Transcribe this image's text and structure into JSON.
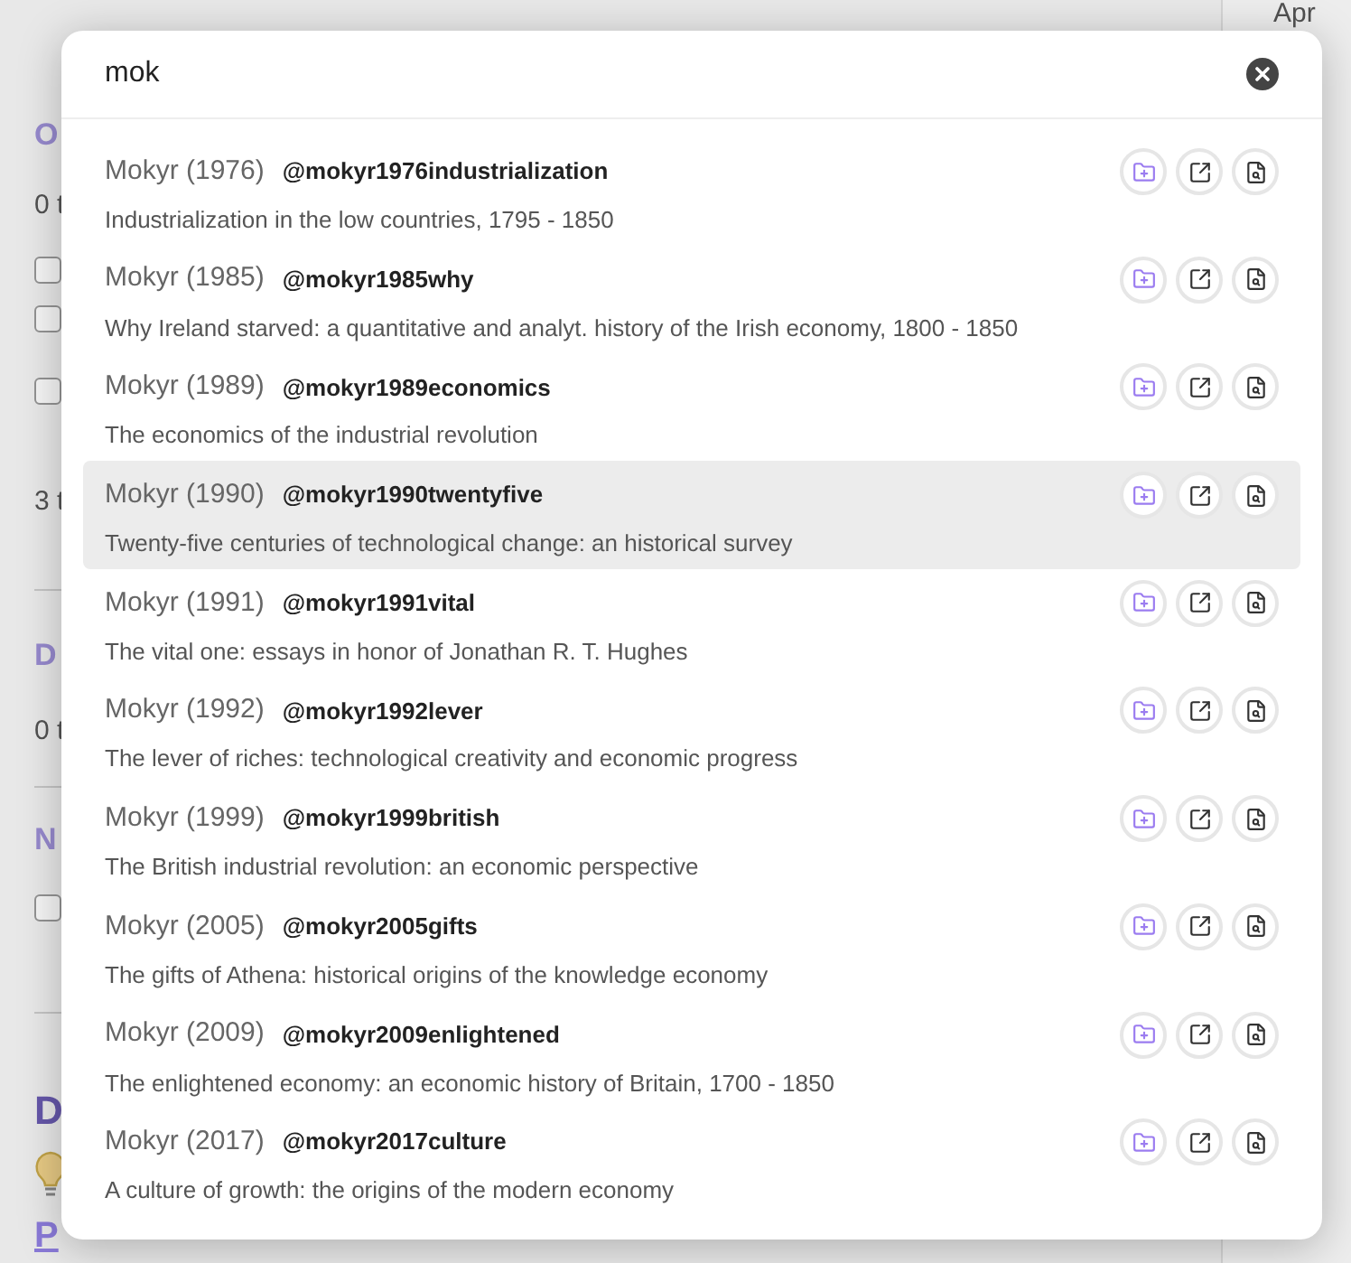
{
  "background": {
    "left_fragments": [
      {
        "kind": "heading",
        "text": "O"
      },
      {
        "kind": "text",
        "text": "0 t"
      },
      {
        "kind": "checkbox",
        "checked": false
      },
      {
        "kind": "checkbox",
        "checked": false
      },
      {
        "kind": "checkbox",
        "checked": false
      },
      {
        "kind": "text",
        "text": "3 t"
      },
      {
        "kind": "divider"
      },
      {
        "kind": "heading",
        "text": "D"
      },
      {
        "kind": "text",
        "text": "0 t"
      },
      {
        "kind": "divider"
      },
      {
        "kind": "heading",
        "text": "N"
      },
      {
        "kind": "checkbox",
        "checked": false
      },
      {
        "kind": "divider"
      },
      {
        "kind": "title",
        "text": "D"
      },
      {
        "kind": "bulb"
      },
      {
        "kind": "link",
        "text": "P"
      }
    ],
    "right_heading": "Apr"
  },
  "search": {
    "value": "mok"
  },
  "results": [
    {
      "author": "Mokyr (1976)",
      "key": "@mokyr1976industrialization",
      "title": "Industrialization in the low countries, 1795 - 1850",
      "selected": false
    },
    {
      "author": "Mokyr (1985)",
      "key": "@mokyr1985why",
      "title": "Why Ireland starved: a quantitative and analyt. history of the Irish economy, 1800 - 1850",
      "selected": false
    },
    {
      "author": "Mokyr (1989)",
      "key": "@mokyr1989economics",
      "title": "The economics of the industrial revolution",
      "selected": false
    },
    {
      "author": "Mokyr (1990)",
      "key": "@mokyr1990twentyfive",
      "title": "Twenty-five centuries of technological change: an historical survey",
      "selected": true
    },
    {
      "author": "Mokyr (1991)",
      "key": "@mokyr1991vital",
      "title": "The vital one: essays in honor of Jonathan R. T. Hughes",
      "selected": false
    },
    {
      "author": "Mokyr (1992)",
      "key": "@mokyr1992lever",
      "title": "The lever of riches: technological creativity and economic progress",
      "selected": false
    },
    {
      "author": "Mokyr (1999)",
      "key": "@mokyr1999british",
      "title": "The British industrial revolution: an economic perspective",
      "selected": false
    },
    {
      "author": "Mokyr (2005)",
      "key": "@mokyr2005gifts",
      "title": "The gifts of Athena: historical origins of the knowledge economy",
      "selected": false
    },
    {
      "author": "Mokyr (2009)",
      "key": "@mokyr2009enlightened",
      "title": "The enlightened economy: an economic history of Britain, 1700 - 1850",
      "selected": false
    },
    {
      "author": "Mokyr (2017)",
      "key": "@mokyr2017culture",
      "title": "A culture of growth: the origins of the modern economy",
      "selected": false
    }
  ]
}
